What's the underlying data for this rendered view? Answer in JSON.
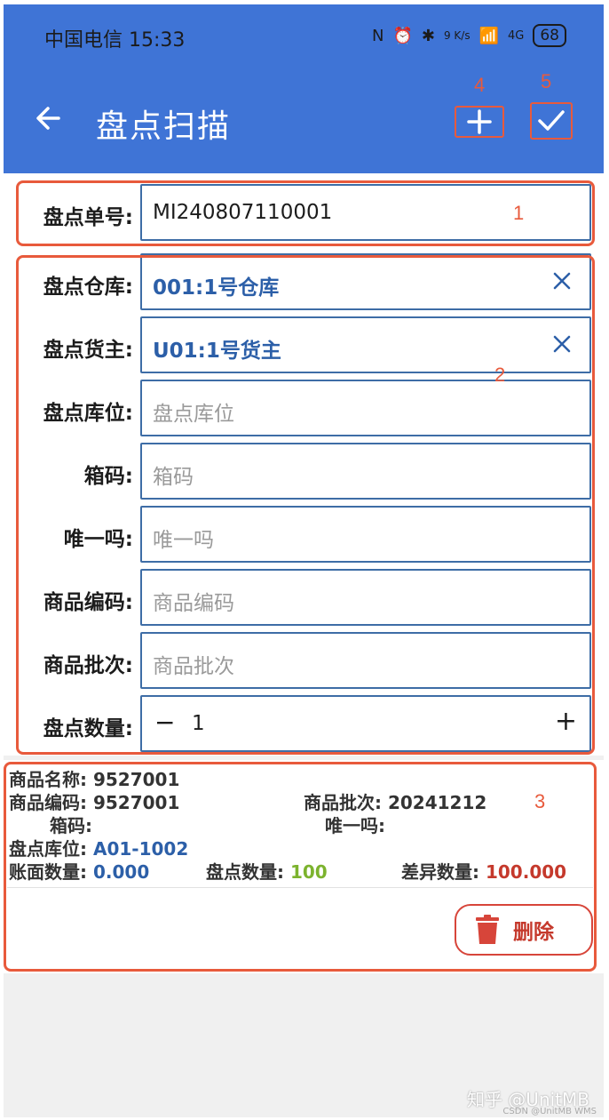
{
  "status_bar": {
    "carrier_time": "中国电信 15:33",
    "speed": "9 K/s",
    "network": "4G",
    "battery": "68"
  },
  "appbar": {
    "title": "盘点扫描",
    "back_icon": "arrow-left-icon",
    "add_icon": "plus-icon",
    "confirm_icon": "check-icon",
    "color": "#3f74d6"
  },
  "annotations": [
    "1",
    "2",
    "3",
    "4",
    "5"
  ],
  "form": {
    "order_no": {
      "label": "盘点单号:",
      "value": "MI240807110001"
    },
    "warehouse": {
      "label": "盘点仓库:",
      "value": "001:1号仓库"
    },
    "owner": {
      "label": "盘点货主:",
      "value": "U01:1号货主"
    },
    "location": {
      "label": "盘点库位:",
      "placeholder": "盘点库位"
    },
    "box_code": {
      "label": "箱码:",
      "placeholder": "箱码"
    },
    "unique_code": {
      "label": "唯一吗:",
      "placeholder": "唯一吗"
    },
    "sku_code": {
      "label": "商品编码:",
      "placeholder": "商品编码"
    },
    "batch": {
      "label": "商品批次:",
      "placeholder": "商品批次"
    },
    "quantity": {
      "label": "盘点数量:",
      "value": "1",
      "minus": "−",
      "plus": "+"
    }
  },
  "record": {
    "name_label": "商品名称:",
    "name_value": "9527001",
    "code_label": "商品编码:",
    "code_value": "9527001",
    "batch_label": "商品批次:",
    "batch_value": "20241212",
    "box_label": "箱码:",
    "unique_label": "唯一吗:",
    "location_label": "盘点库位:",
    "location_value": "A01-1002",
    "book_qty_label": "账面数量:",
    "book_qty_value": "0.000",
    "count_qty_label": "盘点数量:",
    "count_qty_value": "100",
    "diff_qty_label": "差异数量:",
    "diff_qty_value": "100.000",
    "delete_label": "删除"
  },
  "watermark": "知乎 @UnitMB",
  "watermark_small": "CSDN @UnitMB WMS"
}
